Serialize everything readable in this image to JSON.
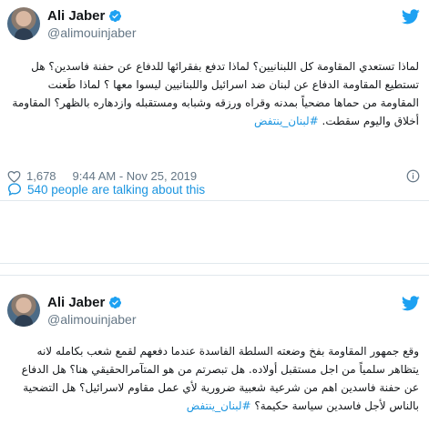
{
  "tweet1": {
    "name": "Ali Jaber",
    "handle": "@alimouinjaber",
    "text": "لماذا تستعدي المقاومة كل اللبنانيين؟ لماذا تدفع بفقرائها للدفاع عن حفنة فاسدين؟ هل تستطيع المقاومة الدفاع عن لبنان ضد اسرائيل واللبنانيين ليسوا معها ؟ لماذا طَعنت المقاومة من حماها مضحياً بمدنه وقراه ورزقه وشبابه ومستقبله وازدهاره بالظهر؟ المقاومة أخلاق واليوم سقطت.",
    "hashtag": "#لبنان_ينتفض",
    "likes": "1,678",
    "date": "9:44 AM - Nov 25, 2019",
    "talking": "540 people are talking about this"
  },
  "tweet2": {
    "name": "Ali Jaber",
    "handle": "@alimouinjaber",
    "text": "وقع جمهور المقاومة بفخ وضعته السلطة الفاسدة عندما دفعهم لقمع شعب بكامله لانه يتظاهر سلمياً من اجل مستقبل أولاده. هل تبصرتم من هو المتآمرالحقيقي هنا؟ هل الدفاع عن حفنة فاسدين اهم من شرعية شعبية ضرورية لأي عمل مقاوم لاسرائيل؟ هل التضحية بالناس لأجل فاسدين سياسة حكيمة؟",
    "hashtag": "#لبنان_ينتفض"
  },
  "colors": {
    "link": "#1b95e0",
    "secondary_text": "#657786",
    "border": "#e1e8ed",
    "verified_badge": "#1da1f2"
  },
  "icons": [
    "twitter-bird-icon",
    "verified-badge-icon",
    "heart-icon",
    "info-icon",
    "speech-bubble-icon"
  ]
}
